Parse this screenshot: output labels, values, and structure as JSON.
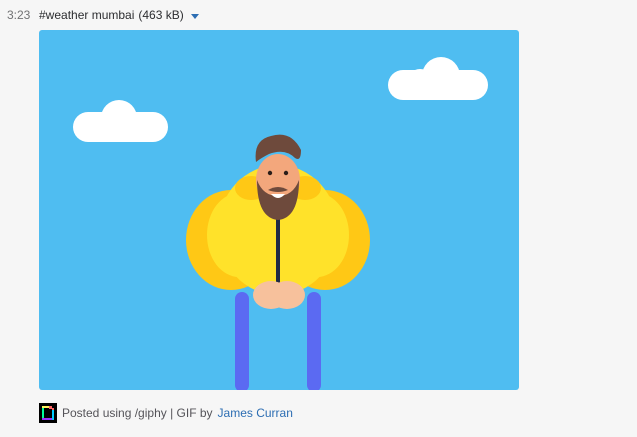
{
  "message": {
    "timestamp": "3:23",
    "file_title": "#weather mumbai",
    "file_size": "(463 kB)"
  },
  "attribution": {
    "posted_text": "Posted using /giphy | GIF by",
    "author": "James Curran",
    "icon": "giphy-logo-icon"
  },
  "colors": {
    "sky": "#4fbdf1",
    "jacket": "#ffd21e",
    "legs": "#5b6af2",
    "link": "#2d6eb3"
  }
}
